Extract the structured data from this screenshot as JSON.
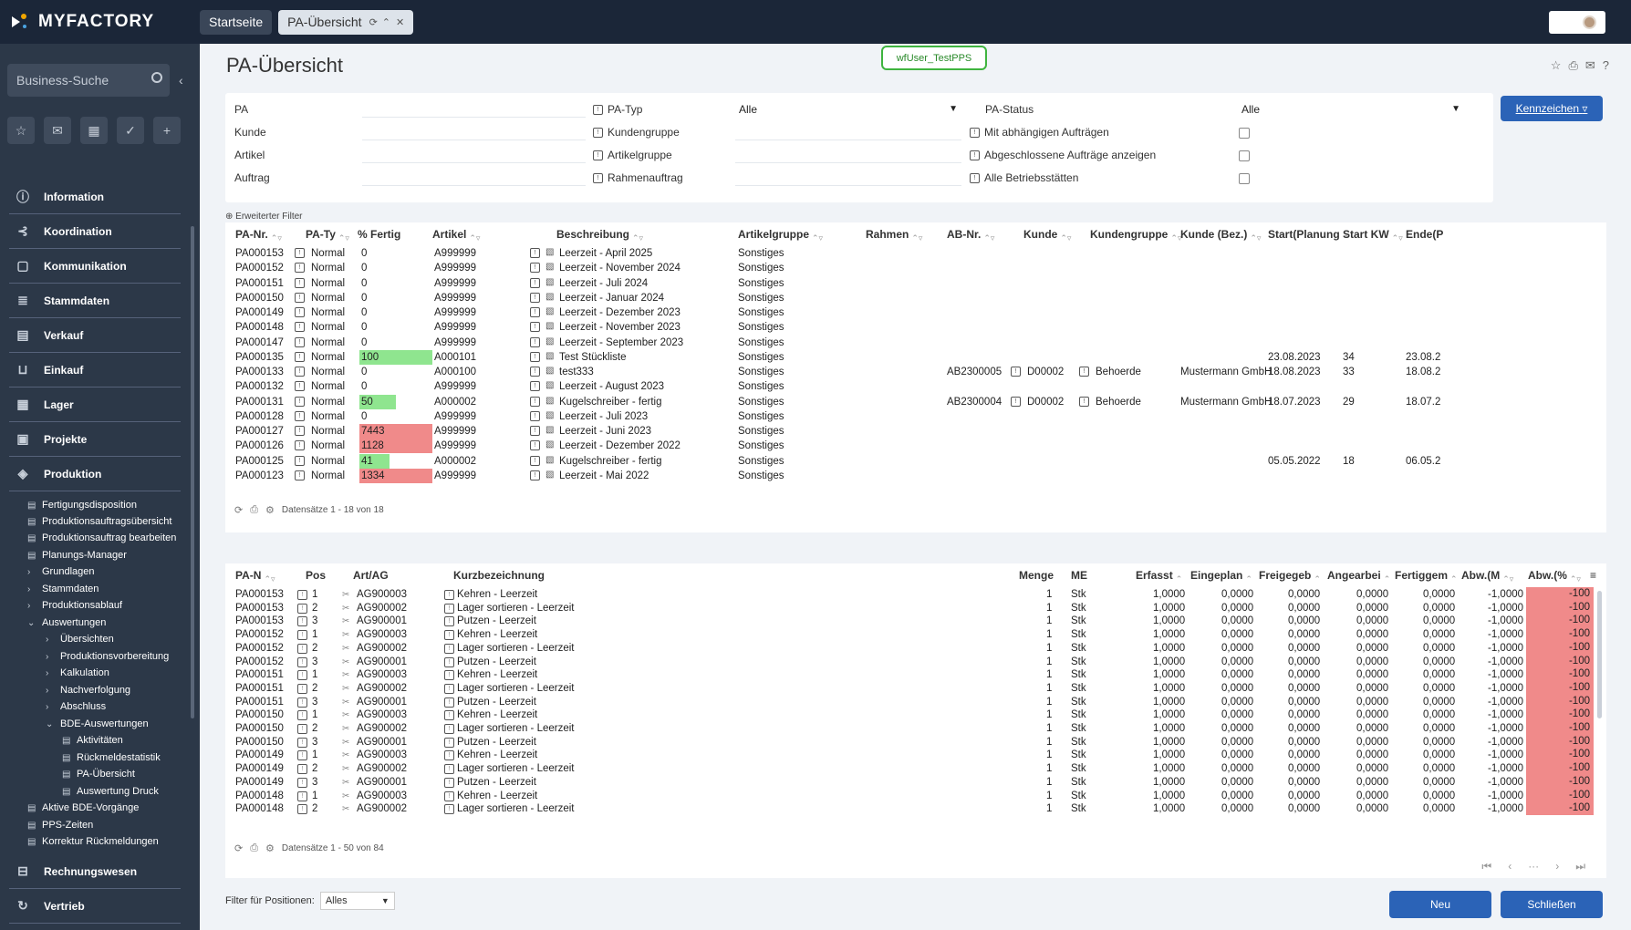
{
  "app": {
    "brand": "MYFACTORY"
  },
  "tabs": [
    {
      "label": "Startseite"
    },
    {
      "label": "PA-Übersicht"
    }
  ],
  "sidebar": {
    "search_placeholder": "Business-Suche",
    "nav": [
      "Information",
      "Koordination",
      "Kommunikation",
      "Stammdaten",
      "Verkauf",
      "Einkauf",
      "Lager",
      "Projekte",
      "Produktion"
    ],
    "produktion_items": [
      "Fertigungsdisposition",
      "Produktionsauftragsübersicht",
      "Produktionsauftrag bearbeiten",
      "Planungs-Manager",
      "Grundlagen",
      "Stammdaten",
      "Produktionsablauf",
      "Auswertungen",
      "Übersichten",
      "Produktionsvorbereitung",
      "Kalkulation",
      "Nachverfolgung",
      "Abschluss",
      "BDE-Auswertungen",
      "Aktivitäten",
      "Rückmeldestatistik",
      "PA-Übersicht",
      "Auswertung Druck",
      "Aktive BDE-Vorgänge",
      "PPS-Zeiten",
      "Korrektur Rückmeldungen"
    ],
    "nav_bottom": [
      "Rechnungswesen",
      "Vertrieb"
    ]
  },
  "page": {
    "title": "PA-Übersicht",
    "user_badge": "wfUser_TestPPS",
    "kennzeichen": "Kennzeichen",
    "extended_filter": "Erweiterter Filter"
  },
  "filters": {
    "pa": "PA",
    "kunde": "Kunde",
    "artikel": "Artikel",
    "auftrag": "Auftrag",
    "pa_typ": "PA-Typ",
    "pa_typ_value": "Alle",
    "kundengruppe": "Kundengruppe",
    "artikelgruppe": "Artikelgruppe",
    "rahmenauftrag": "Rahmenauftrag",
    "pa_status": "PA-Status",
    "pa_status_value": "Alle",
    "mit_abh": "Mit abhängigen Aufträgen",
    "abgeschlossen": "Abgeschlossene Aufträge anzeigen",
    "alle_betrieb": "Alle Betriebsstätten"
  },
  "grid1": {
    "columns": [
      "PA-Nr.",
      "PA-Ty",
      "% Fertig",
      "Artikel",
      "Beschreibung",
      "Artikelgruppe",
      "Rahmen",
      "AB-Nr.",
      "Kunde",
      "Kundengruppe",
      "Kunde (Bez.)",
      "Start(Planung",
      "Start KW",
      "Ende(P"
    ],
    "rows": [
      {
        "pa": "PA000153",
        "typ": "Normal",
        "pct": "0",
        "art": "A999999",
        "desc": "Leerzeit - April 2025",
        "grp": "Sonstiges",
        "ab": "",
        "kunde": "",
        "kgrp": "",
        "kbez": "",
        "start": "",
        "kw": "",
        "ende": ""
      },
      {
        "pa": "PA000152",
        "typ": "Normal",
        "pct": "0",
        "art": "A999999",
        "desc": "Leerzeit - November 2024",
        "grp": "Sonstiges",
        "ab": "",
        "kunde": "",
        "kgrp": "",
        "kbez": "",
        "start": "",
        "kw": "",
        "ende": ""
      },
      {
        "pa": "PA000151",
        "typ": "Normal",
        "pct": "0",
        "art": "A999999",
        "desc": "Leerzeit - Juli 2024",
        "grp": "Sonstiges",
        "ab": "",
        "kunde": "",
        "kgrp": "",
        "kbez": "",
        "start": "",
        "kw": "",
        "ende": ""
      },
      {
        "pa": "PA000150",
        "typ": "Normal",
        "pct": "0",
        "art": "A999999",
        "desc": "Leerzeit - Januar 2024",
        "grp": "Sonstiges",
        "ab": "",
        "kunde": "",
        "kgrp": "",
        "kbez": "",
        "start": "",
        "kw": "",
        "ende": ""
      },
      {
        "pa": "PA000149",
        "typ": "Normal",
        "pct": "0",
        "art": "A999999",
        "desc": "Leerzeit - Dezember 2023",
        "grp": "Sonstiges",
        "ab": "",
        "kunde": "",
        "kgrp": "",
        "kbez": "",
        "start": "",
        "kw": "",
        "ende": ""
      },
      {
        "pa": "PA000148",
        "typ": "Normal",
        "pct": "0",
        "art": "A999999",
        "desc": "Leerzeit - November 2023",
        "grp": "Sonstiges",
        "ab": "",
        "kunde": "",
        "kgrp": "",
        "kbez": "",
        "start": "",
        "kw": "",
        "ende": ""
      },
      {
        "pa": "PA000147",
        "typ": "Normal",
        "pct": "0",
        "art": "A999999",
        "desc": "Leerzeit - September 2023",
        "grp": "Sonstiges",
        "ab": "",
        "kunde": "",
        "kgrp": "",
        "kbez": "",
        "start": "",
        "kw": "",
        "ende": ""
      },
      {
        "pa": "PA000135",
        "typ": "Normal",
        "pct": "100",
        "art": "A000101",
        "desc": "Test Stückliste",
        "grp": "Sonstiges",
        "ab": "",
        "kunde": "",
        "kgrp": "",
        "kbez": "",
        "start": "23.08.2023",
        "kw": "34",
        "ende": "23.08.2"
      },
      {
        "pa": "PA000133",
        "typ": "Normal",
        "pct": "0",
        "art": "A000100",
        "desc": "test333",
        "grp": "Sonstiges",
        "ab": "AB2300005",
        "kunde": "D00002",
        "kgrp": "Behoerde",
        "kbez": "Mustermann GmbH",
        "start": "18.08.2023",
        "kw": "33",
        "ende": "18.08.2"
      },
      {
        "pa": "PA000132",
        "typ": "Normal",
        "pct": "0",
        "art": "A999999",
        "desc": "Leerzeit - August 2023",
        "grp": "Sonstiges",
        "ab": "",
        "kunde": "",
        "kgrp": "",
        "kbez": "",
        "start": "",
        "kw": "",
        "ende": ""
      },
      {
        "pa": "PA000131",
        "typ": "Normal",
        "pct": "50",
        "art": "A000002",
        "desc": "Kugelschreiber - fertig",
        "grp": "Sonstiges",
        "ab": "AB2300004",
        "kunde": "D00002",
        "kgrp": "Behoerde",
        "kbez": "Mustermann GmbH",
        "start": "18.07.2023",
        "kw": "29",
        "ende": "18.07.2"
      },
      {
        "pa": "PA000128",
        "typ": "Normal",
        "pct": "0",
        "art": "A999999",
        "desc": "Leerzeit - Juli 2023",
        "grp": "Sonstiges",
        "ab": "",
        "kunde": "",
        "kgrp": "",
        "kbez": "",
        "start": "",
        "kw": "",
        "ende": ""
      },
      {
        "pa": "PA000127",
        "typ": "Normal",
        "pct": "7443",
        "art": "A999999",
        "desc": "Leerzeit - Juni 2023",
        "grp": "Sonstiges",
        "ab": "",
        "kunde": "",
        "kgrp": "",
        "kbez": "",
        "start": "",
        "kw": "",
        "ende": ""
      },
      {
        "pa": "PA000126",
        "typ": "Normal",
        "pct": "1128",
        "art": "A999999",
        "desc": "Leerzeit - Dezember 2022",
        "grp": "Sonstiges",
        "ab": "",
        "kunde": "",
        "kgrp": "",
        "kbez": "",
        "start": "",
        "kw": "",
        "ende": ""
      },
      {
        "pa": "PA000125",
        "typ": "Normal",
        "pct": "41",
        "art": "A000002",
        "desc": "Kugelschreiber - fertig",
        "grp": "Sonstiges",
        "ab": "",
        "kunde": "",
        "kgrp": "",
        "kbez": "",
        "start": "05.05.2022",
        "kw": "18",
        "ende": "06.05.2"
      },
      {
        "pa": "PA000123",
        "typ": "Normal",
        "pct": "1334",
        "art": "A999999",
        "desc": "Leerzeit - Mai 2022",
        "grp": "Sonstiges",
        "ab": "",
        "kunde": "",
        "kgrp": "",
        "kbez": "",
        "start": "",
        "kw": "",
        "ende": ""
      }
    ],
    "footer": "Datensätze 1 - 18 von 18"
  },
  "grid2": {
    "columns": [
      "PA-N",
      "Pos",
      "Art/AG",
      "Kurzbezeichnung",
      "Menge",
      "ME",
      "Erfasst",
      "Eingeplan",
      "Freigegeb",
      "Angearbei",
      "Fertiggem",
      "Abw.(M",
      "Abw.(%"
    ],
    "rows": [
      {
        "pa": "PA000153",
        "pos": "1",
        "ag": "AG900003",
        "kb": "Kehren - Leerzeit"
      },
      {
        "pa": "PA000153",
        "pos": "2",
        "ag": "AG900002",
        "kb": "Lager sortieren - Leerzeit"
      },
      {
        "pa": "PA000153",
        "pos": "3",
        "ag": "AG900001",
        "kb": "Putzen - Leerzeit"
      },
      {
        "pa": "PA000152",
        "pos": "1",
        "ag": "AG900003",
        "kb": "Kehren - Leerzeit"
      },
      {
        "pa": "PA000152",
        "pos": "2",
        "ag": "AG900002",
        "kb": "Lager sortieren - Leerzeit"
      },
      {
        "pa": "PA000152",
        "pos": "3",
        "ag": "AG900001",
        "kb": "Putzen - Leerzeit"
      },
      {
        "pa": "PA000151",
        "pos": "1",
        "ag": "AG900003",
        "kb": "Kehren - Leerzeit"
      },
      {
        "pa": "PA000151",
        "pos": "2",
        "ag": "AG900002",
        "kb": "Lager sortieren - Leerzeit"
      },
      {
        "pa": "PA000151",
        "pos": "3",
        "ag": "AG900001",
        "kb": "Putzen - Leerzeit"
      },
      {
        "pa": "PA000150",
        "pos": "1",
        "ag": "AG900003",
        "kb": "Kehren - Leerzeit"
      },
      {
        "pa": "PA000150",
        "pos": "2",
        "ag": "AG900002",
        "kb": "Lager sortieren - Leerzeit"
      },
      {
        "pa": "PA000150",
        "pos": "3",
        "ag": "AG900001",
        "kb": "Putzen - Leerzeit"
      },
      {
        "pa": "PA000149",
        "pos": "1",
        "ag": "AG900003",
        "kb": "Kehren - Leerzeit"
      },
      {
        "pa": "PA000149",
        "pos": "2",
        "ag": "AG900002",
        "kb": "Lager sortieren - Leerzeit"
      },
      {
        "pa": "PA000149",
        "pos": "3",
        "ag": "AG900001",
        "kb": "Putzen - Leerzeit"
      },
      {
        "pa": "PA000148",
        "pos": "1",
        "ag": "AG900003",
        "kb": "Kehren - Leerzeit"
      },
      {
        "pa": "PA000148",
        "pos": "2",
        "ag": "AG900002",
        "kb": "Lager sortieren - Leerzeit"
      }
    ],
    "values": {
      "menge": "1",
      "me": "Stk",
      "erfasst": "1,0000",
      "eingeplant": "0,0000",
      "freigegeben": "0,0000",
      "angearbeitet": "0,0000",
      "fertig": "0,0000",
      "abw_m": "-1,0000",
      "abw_p": "-100"
    },
    "footer": "Datensätze 1 - 50 von 84"
  },
  "bottom": {
    "posfilter_label": "Filter für Positionen:",
    "posfilter_value": "Alles",
    "neu": "Neu",
    "schliessen": "Schließen"
  },
  "colors": {
    "topbar": "#1b2638",
    "sidebar": "#2c3848",
    "accent": "#2b63b7",
    "green": "#8fe58f",
    "red": "#f08a8a"
  }
}
